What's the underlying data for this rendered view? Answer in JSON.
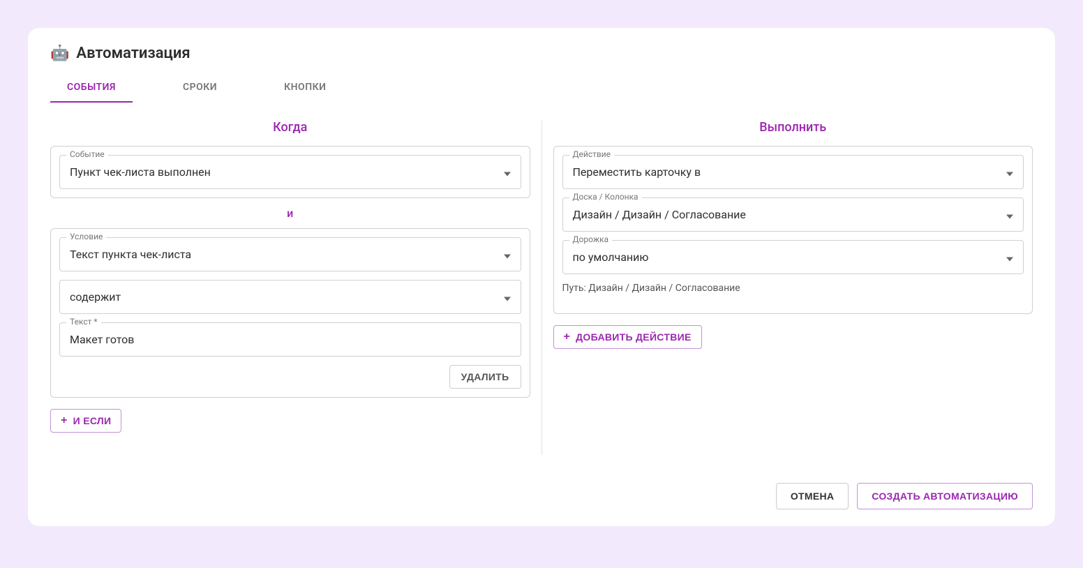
{
  "header": {
    "icon": "🤖",
    "title": "Автоматизация"
  },
  "tabs": {
    "events": "СОБЫТИЯ",
    "deadlines": "СРОКИ",
    "buttons": "КНОПКИ"
  },
  "when": {
    "title": "Когда",
    "event_label": "Событие",
    "event_value": "Пункт чек-листа выполнен",
    "connector": "и",
    "condition_label": "Условие",
    "condition_value": "Текст пункта чек-листа",
    "operator_value": "содержит",
    "text_label": "Текст *",
    "text_value": "Макет готов",
    "delete_btn": "УДАЛИТЬ",
    "add_condition_btn": "И ЕСЛИ"
  },
  "execute": {
    "title": "Выполнить",
    "action_label": "Действие",
    "action_value": "Переместить карточку в",
    "board_label": "Доска / Колонка",
    "board_value": "Дизайн / Дизайн / Согласование",
    "lane_label": "Дорожка",
    "lane_value": "по умолчанию",
    "path_text": "Путь: Дизайн / Дизайн / Согласование",
    "add_action_btn": "ДОБАВИТЬ ДЕЙСТВИЕ"
  },
  "footer": {
    "cancel": "ОТМЕНА",
    "create": "СОЗДАТЬ АВТОМАТИЗАЦИЮ"
  }
}
